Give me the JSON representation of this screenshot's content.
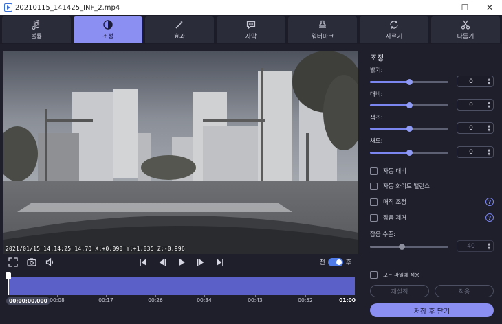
{
  "window": {
    "title": "20210115_141425_INF_2.mp4",
    "controls": [
      "minimize-icon",
      "maximize-icon",
      "close-icon"
    ]
  },
  "tabs": [
    {
      "label": "볼륨",
      "icon": "music-note-icon",
      "active": false
    },
    {
      "label": "조정",
      "icon": "contrast-icon",
      "active": true
    },
    {
      "label": "효과",
      "icon": "magic-wand-icon",
      "active": false
    },
    {
      "label": "자막",
      "icon": "speech-bubble-icon",
      "active": false
    },
    {
      "label": "워터마크",
      "icon": "stamp-icon",
      "active": false
    },
    {
      "label": "자르기",
      "icon": "crop-rotate-icon",
      "active": false
    },
    {
      "label": "다듬기",
      "icon": "scissors-icon",
      "active": false
    }
  ],
  "video": {
    "overlay_text": "2021/01/15 14:14:25 14.7Q X:+0.090 Y:+1.035 Z:-0.996"
  },
  "player": {
    "compare_before": "전",
    "compare_after": "후",
    "compare_on": true
  },
  "timeline": {
    "current": "00:00:00.000",
    "ticks": [
      "00:08",
      "00:17",
      "00:26",
      "00:34",
      "00:43",
      "00:52"
    ],
    "end": "01:00",
    "position": 0
  },
  "panel": {
    "title": "조정",
    "sliders": [
      {
        "label": "밝기:",
        "value": "0",
        "level": 0.5
      },
      {
        "label": "대비:",
        "value": "0",
        "level": 0.5
      },
      {
        "label": "색조:",
        "value": "0",
        "level": 0.5
      },
      {
        "label": "채도:",
        "value": "0",
        "level": 0.5
      }
    ],
    "checkboxes": [
      {
        "label": "자동 대비",
        "checked": false,
        "help": false
      },
      {
        "label": "자동 화이트 밸런스",
        "checked": false,
        "help": false
      },
      {
        "label": "매직 조정",
        "checked": false,
        "help": true
      },
      {
        "label": "잡음 제거",
        "checked": false,
        "help": true
      }
    ],
    "noise_level": {
      "label": "잡음 수준:",
      "value": "40",
      "level": 0.4
    },
    "apply_all": "모든 파일에 적용",
    "reset": "재설정",
    "apply": "적용",
    "save_close": "저장 후 닫기"
  },
  "colors": {
    "accent": "#8c8ff2",
    "background": "#1e1f2b",
    "track": "#5a60c8"
  }
}
